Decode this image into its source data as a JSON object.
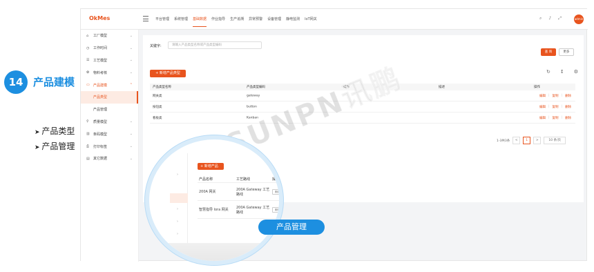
{
  "left_panel": {
    "step_number": "14",
    "step_title": "产品建模",
    "bullets": [
      "产品类型",
      "产品管理"
    ]
  },
  "topbar": {
    "logo": "OkMes",
    "nav": [
      "平台管理",
      "系统管理",
      "基础数据",
      "作业指导",
      "生产追溯",
      "异常预警",
      "设备管理",
      "静电监测",
      "IoT网关"
    ],
    "active_nav": "基础数据",
    "avatar": "admin",
    "icons": [
      "search-icon",
      "bell-icon",
      "fullscreen-icon"
    ]
  },
  "sidebar": {
    "items": [
      {
        "label": "工厂模型",
        "icon": "factory-icon"
      },
      {
        "label": "工作时间",
        "icon": "clock-icon"
      },
      {
        "label": "工艺模型",
        "icon": "process-icon"
      },
      {
        "label": "物料考核",
        "icon": "material-icon"
      },
      {
        "label": "产品建模",
        "icon": "product-icon",
        "active": true
      },
      {
        "label": "产品类型",
        "sub": true,
        "active": true
      },
      {
        "label": "产品管理",
        "sub": true
      },
      {
        "label": "质量模型",
        "icon": "quality-icon"
      },
      {
        "label": "条码模型",
        "icon": "barcode-icon"
      },
      {
        "label": "打印标签",
        "icon": "print-icon"
      },
      {
        "label": "其它数据",
        "icon": "data-icon"
      }
    ]
  },
  "search": {
    "keyword_label": "关键字:",
    "keyword_placeholder": "请输入产品类型名称或产品类型编码",
    "search_button": "查 询",
    "more_button": "更多"
  },
  "table": {
    "add_button": "+ 新增产品类型",
    "columns": [
      "产品类型名称",
      "产品类型编码",
      "排序",
      "描述",
      "操作"
    ],
    "rows": [
      {
        "name": "网关类",
        "code": "gateway",
        "sort": "",
        "desc": ""
      },
      {
        "name": "按钮类",
        "code": "button",
        "sort": "",
        "desc": ""
      },
      {
        "name": "看板类",
        "code": "Kanban",
        "sort": "",
        "desc": ""
      }
    ],
    "actions": [
      "编辑",
      "复制",
      "删除"
    ],
    "pagination": {
      "summary": "1-3共3条",
      "prev": "<",
      "page": "1",
      "next": ">",
      "page_size": "10 条/页"
    }
  },
  "watermark": "SUNPN讯鹏",
  "zoom": {
    "add_button": "+ 新增产品",
    "columns": [
      "产品名称",
      "工艺路线",
      "操作书"
    ],
    "rows": [
      {
        "name": "200A 网关",
        "route": "200A Gateway 工艺路线",
        "btn": "未绑定"
      },
      {
        "name": "智慧指导 lora 网关",
        "route": "200A Gateway 工艺路线",
        "btn": "未绑定"
      }
    ],
    "label": "产品管理"
  }
}
